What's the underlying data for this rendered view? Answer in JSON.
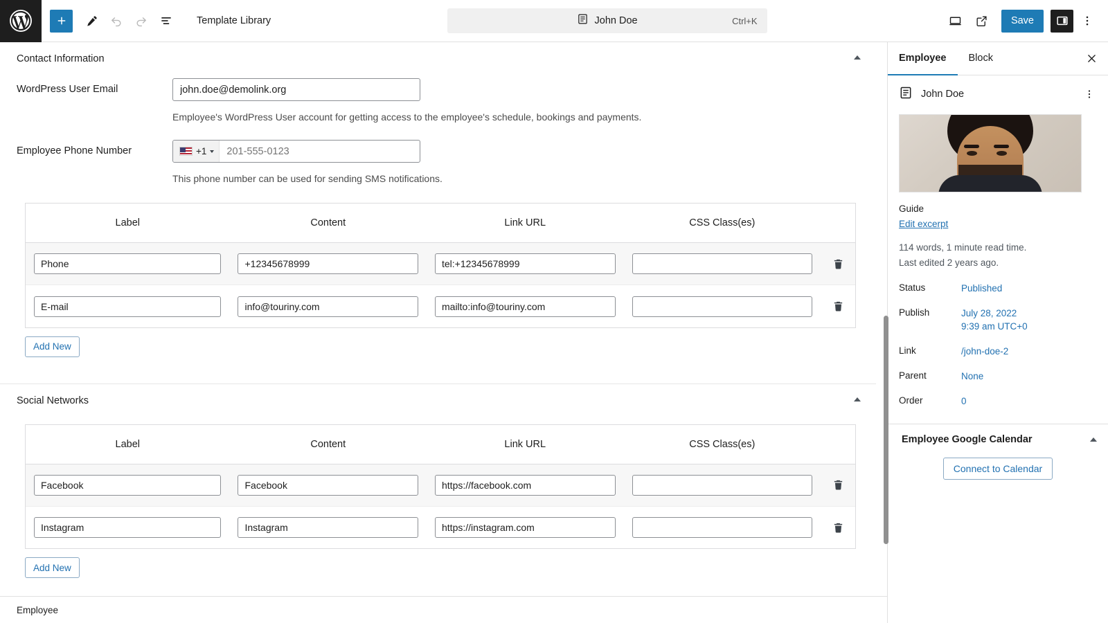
{
  "toolbar": {
    "logo_icon": "wordpress-logo-icon",
    "add_label": "+",
    "add_icon": "plus-icon",
    "edit_icon": "pencil-icon",
    "undo_icon": "undo-arrow-icon",
    "redo_icon": "redo-arrow-icon",
    "list_view_icon": "list-view-icon",
    "template_label": "Template Library",
    "command_title": "John Doe",
    "command_icon": "document-icon",
    "command_shortcut": "Ctrl+K",
    "view_icon": "desktop-preview-icon",
    "external_icon": "external-link-icon",
    "save_label": "Save",
    "settings_toggle_icon": "sidebar-toggle-icon",
    "options_icon": "kebab-menu-icon",
    "accent_color": "#1e7bb5"
  },
  "contact_section": {
    "title": "Contact Information",
    "email_field": {
      "label": "WordPress User Email",
      "value": "john.doe@demolink.org",
      "help": "Employee's WordPress User account for getting access to the employee's schedule, bookings and payments."
    },
    "phone_field": {
      "label": "Employee Phone Number",
      "dial_code": "+1",
      "flag": "us-flag-icon",
      "placeholder": "201-555-0123",
      "value": "",
      "help": "This phone number can be used for sending SMS notifications."
    },
    "table": {
      "columns": [
        "Label",
        "Content",
        "Link URL",
        "CSS Class(es)"
      ],
      "rows": [
        {
          "label": "Phone",
          "content": "+12345678999",
          "link": "tel:+12345678999",
          "css": ""
        },
        {
          "label": "E-mail",
          "content": "info@touriny.com",
          "link": "mailto:info@touriny.com",
          "css": ""
        }
      ],
      "delete_icon": "trash-icon",
      "add_new_label": "Add New"
    }
  },
  "social_section": {
    "title": "Social Networks",
    "table": {
      "columns": [
        "Label",
        "Content",
        "Link URL",
        "CSS Class(es)"
      ],
      "rows": [
        {
          "label": "Facebook",
          "content": "Facebook",
          "link": "https://facebook.com",
          "css": ""
        },
        {
          "label": "Instagram",
          "content": "Instagram",
          "link": "https://instagram.com",
          "css": ""
        }
      ],
      "delete_icon": "trash-icon",
      "add_new_label": "Add New"
    }
  },
  "sidebar": {
    "tabs": [
      {
        "label": "Employee",
        "active": true
      },
      {
        "label": "Block",
        "active": false
      }
    ],
    "close_icon": "close-icon",
    "document": {
      "icon": "document-icon",
      "title": "John Doe",
      "kebab_icon": "kebab-menu-icon"
    },
    "featured_image_alt": "employee-portrait",
    "guide_label": "Guide",
    "edit_excerpt_label": "Edit excerpt",
    "word_count": "114 words, 1 minute read time.",
    "last_edited": "Last edited 2 years ago.",
    "meta": [
      {
        "key": "Status",
        "value": "Published"
      },
      {
        "key": "Publish",
        "value": "July 28, 2022\n9:39 am UTC+0"
      },
      {
        "key": "Link",
        "value": "/john-doe-2"
      },
      {
        "key": "Parent",
        "value": "None"
      },
      {
        "key": "Order",
        "value": "0"
      }
    ],
    "calendar_panel": {
      "title": "Employee Google Calendar",
      "button_label": "Connect to Calendar"
    }
  },
  "footer": {
    "breadcrumb": "Employee"
  }
}
